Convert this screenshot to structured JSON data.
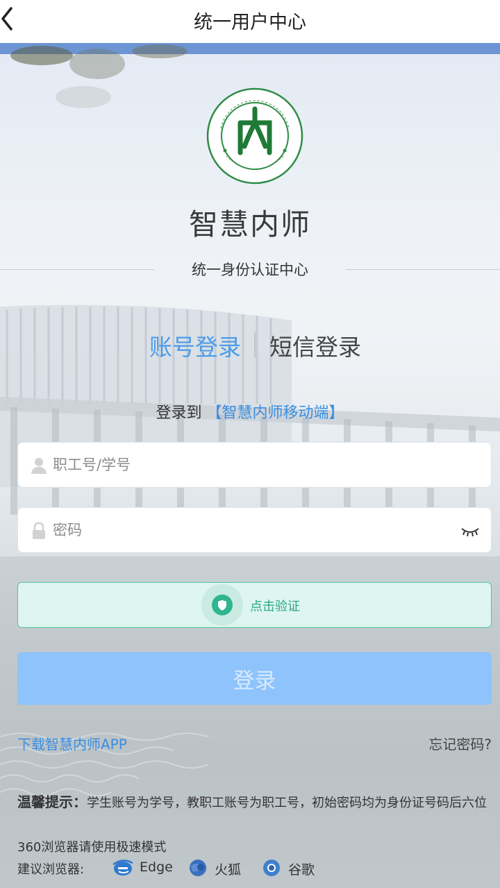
{
  "navbar": {
    "title": "统一用户中心"
  },
  "brand": {
    "name": "智慧内师",
    "subtitle": "统一身份认证中心",
    "logo_text": "内江师范学院 NEIJIANG NORMAL UNIVERSITY 1956"
  },
  "tabs": [
    {
      "label": "账号登录",
      "active": true
    },
    {
      "label": "短信登录",
      "active": false
    }
  ],
  "login_target": {
    "prefix": "登录到",
    "app": "【智慧内师移动端】"
  },
  "username": {
    "placeholder": "职工号/学号",
    "value": ""
  },
  "password": {
    "placeholder": "密码",
    "value": ""
  },
  "captcha": {
    "label": "点击验证"
  },
  "login_button": {
    "label": "登录"
  },
  "links": {
    "download": "下载智慧内师APP",
    "forgot": "忘记密码?"
  },
  "tips": {
    "title": "温馨提示：",
    "text": "学生账号为学号，教职工账号为职工号，初始密码均为身份证号码后六位",
    "browser_note": "360浏览器请使用极速模式",
    "browsers_label": "建议浏览器:",
    "browsers": [
      {
        "name": "Edge",
        "icon": "edge-icon"
      },
      {
        "name": "火狐",
        "icon": "firefox-icon"
      },
      {
        "name": "谷歌",
        "icon": "chrome-icon"
      }
    ]
  },
  "colors": {
    "accent": "#4a9be8",
    "captcha": "#2fb58f",
    "login_button": "#8ec3fb",
    "header_strip": "#6d95d4"
  }
}
